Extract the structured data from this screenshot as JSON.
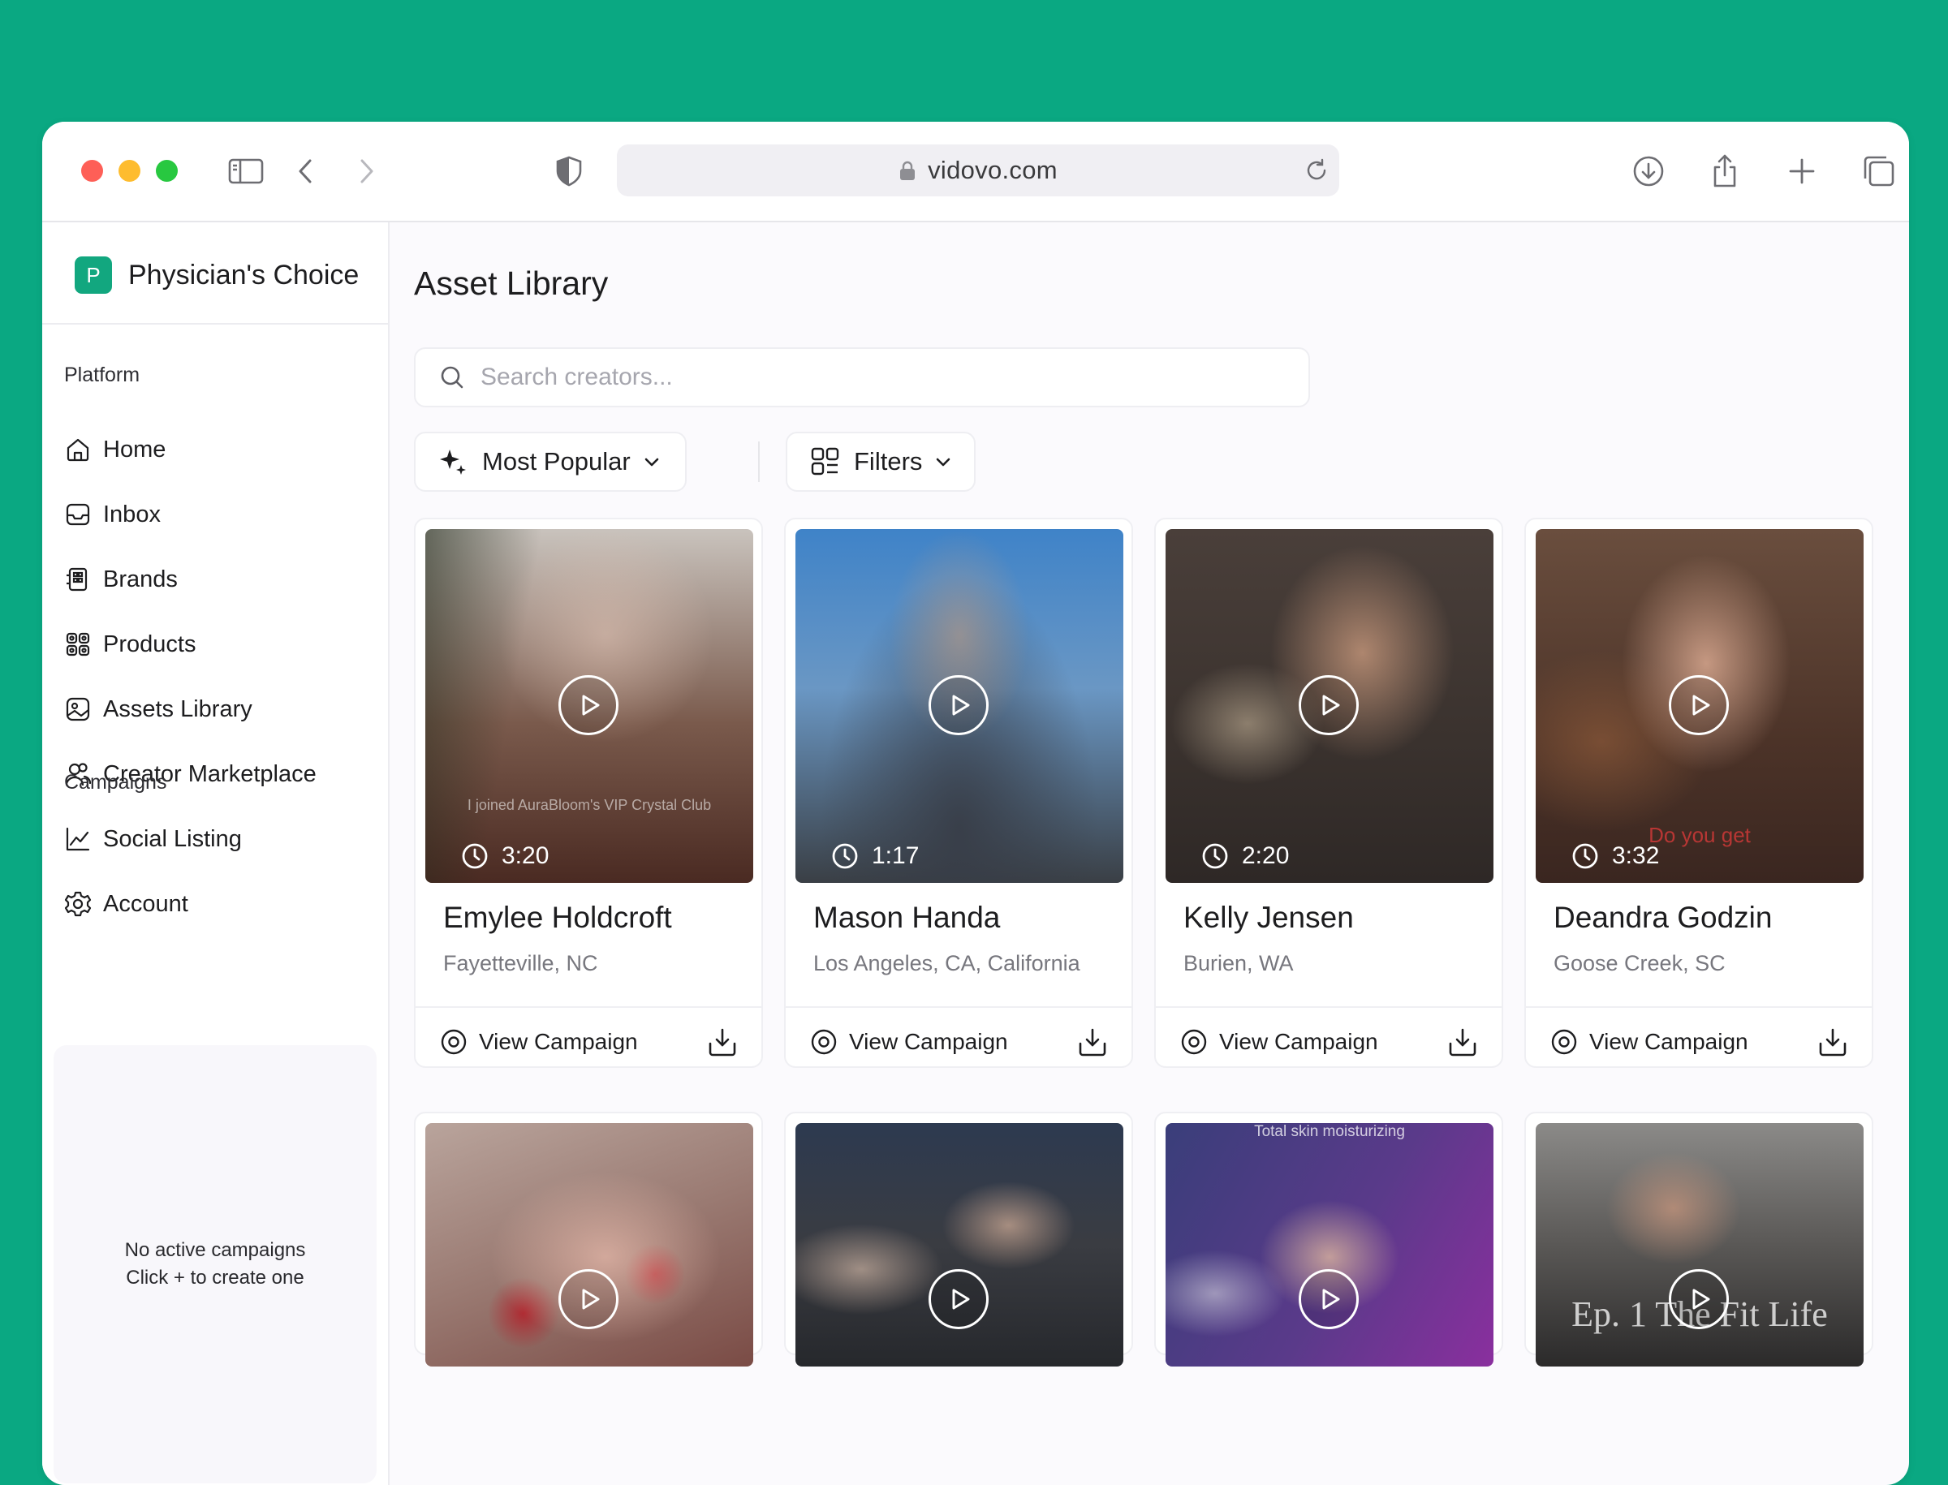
{
  "browser": {
    "url": "vidovo.com"
  },
  "sidebar": {
    "brand_initial": "P",
    "brand_name": "Physician's Choice",
    "platform_label": "Platform",
    "nav": [
      {
        "label": "Home",
        "icon": "home-icon"
      },
      {
        "label": "Inbox",
        "icon": "inbox-icon"
      },
      {
        "label": "Brands",
        "icon": "brands-icon"
      },
      {
        "label": "Products",
        "icon": "products-icon"
      },
      {
        "label": "Assets Library",
        "icon": "image-icon"
      },
      {
        "label": "Creator Marketplace",
        "icon": "users-icon"
      },
      {
        "label": "Social Listing",
        "icon": "chart-icon"
      },
      {
        "label": "Account",
        "icon": "gear-icon"
      }
    ],
    "campaigns_label": "Campaigns",
    "campaigns_empty_line1": "No active campaigns",
    "campaigns_empty_line2": "Click + to create one"
  },
  "main": {
    "title": "Asset Library",
    "search_placeholder": "Search creators...",
    "sort_label": "Most Popular",
    "filters_label": "Filters",
    "view_campaign_label": "View Campaign",
    "cards": [
      {
        "name": "Emylee Holdcroft",
        "location": "Fayetteville, NC",
        "duration": "3:20",
        "caption": "I joined AuraBloom's VIP Crystal Club",
        "color_top": "#c9c3bd",
        "color_bottom": "#4a2a22"
      },
      {
        "name": "Mason Handa",
        "location": "Los Angeles, CA, California",
        "duration": "1:17",
        "caption": "",
        "color_top": "#3f83c8",
        "color_bottom": "#3a3f45"
      },
      {
        "name": "Kelly Jensen",
        "location": "Burien, WA",
        "duration": "2:20",
        "caption": "",
        "color_top": "#4a3f3a",
        "color_bottom": "#2e2826"
      },
      {
        "name": "Deandra Godzin",
        "location": "Goose Creek, SC",
        "duration": "3:32",
        "caption": "Do you get",
        "color_top": "#6a4e3e",
        "color_bottom": "#3a2620"
      }
    ],
    "row2": [
      {
        "overlay": "",
        "color_top": "#b9a49c",
        "color_bottom": "#7a4b45"
      },
      {
        "overlay": "",
        "color_top": "#2d3a50",
        "color_bottom": "#26282c"
      },
      {
        "overlay": "Total skin moisturizing",
        "color_top": "#3a3e7a",
        "color_bottom": "#8a2f9e"
      },
      {
        "overlay": "Ep. 1 The Fit Life",
        "color_top": "#8b8a88",
        "color_bottom": "#2b2a2a"
      }
    ]
  }
}
